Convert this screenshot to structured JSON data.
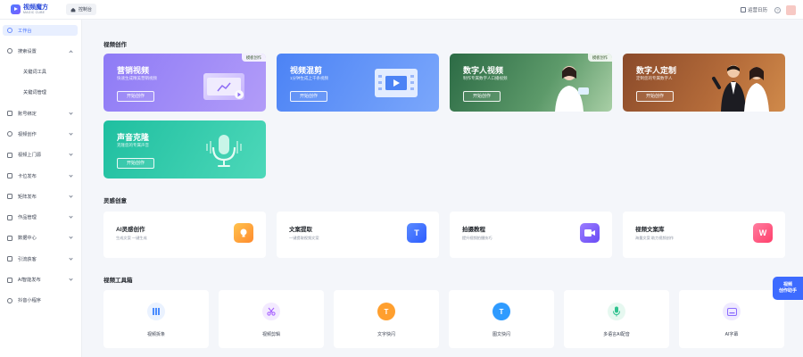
{
  "app": {
    "name": "视频魔方",
    "subtitle": "MAGIC CUBE",
    "home_tab": "控制台"
  },
  "topbar": {
    "calendar_label": "运营日历",
    "help_glyph": "?"
  },
  "sidebar": {
    "items": [
      {
        "label": "工作台",
        "icon": "home-icon",
        "active": true
      },
      {
        "label": "搜索设置",
        "icon": "search-icon",
        "expanded": true
      },
      {
        "label": "关键词工具",
        "sub": true
      },
      {
        "label": "关键词管理",
        "sub": true
      },
      {
        "label": "账号绑定",
        "icon": "account-icon"
      },
      {
        "label": "视频创作",
        "icon": "video-icon"
      },
      {
        "label": "视频上门源",
        "icon": "upload-icon"
      },
      {
        "label": "卡位发布",
        "icon": "publish-icon"
      },
      {
        "label": "矩阵发布",
        "icon": "matrix-icon"
      },
      {
        "label": "作品管理",
        "icon": "works-icon"
      },
      {
        "label": "数据中心",
        "icon": "data-icon"
      },
      {
        "label": "引流获客",
        "icon": "traffic-icon"
      },
      {
        "label": "AI智能发布",
        "icon": "ai-publish-icon"
      },
      {
        "label": "抖音小程序",
        "icon": "miniapp-icon"
      }
    ]
  },
  "sections": {
    "creation": "视频创作",
    "inspiration": "灵感创意",
    "tools": "视频工具箱"
  },
  "creation_cards": [
    {
      "title": "营销视频",
      "desc": "快速生成精美营销视频",
      "button": "开始创作",
      "badge": "模板创作"
    },
    {
      "title": "视频混剪",
      "desc": "1分钟生成上千条视频",
      "button": "开始创作"
    },
    {
      "title": "数字人视频",
      "desc": "制作专属数字人口播视频",
      "button": "开始创作",
      "badge": "模板创作"
    },
    {
      "title": "数字人定制",
      "desc": "定制您的专属数字人",
      "button": "开始创作"
    },
    {
      "title": "声音克隆",
      "desc": "克隆您的专属声音",
      "button": "开始创作"
    }
  ],
  "inspiration_cards": [
    {
      "title": "AI灵感创作",
      "desc": "生成文案 一键生成",
      "icon": "bulb-icon",
      "color": "#ff9f2e"
    },
    {
      "title": "文案提取",
      "desc": "一键提取视频文案",
      "icon": "text-extract-icon",
      "glyph": "T",
      "color": "#3d6bff"
    },
    {
      "title": "拍摄教程",
      "desc": "提升视频拍摄技巧",
      "icon": "tutorial-icon",
      "color": "#7a5cff"
    },
    {
      "title": "视频文案库",
      "desc": "海量文案 助力视频创作",
      "icon": "library-icon",
      "glyph": "W",
      "color": "#ff4f7b"
    }
  ],
  "tools": [
    {
      "label": "视频拆条",
      "icon": "split-icon",
      "color": "#4a8cff"
    },
    {
      "label": "视频剪辑",
      "icon": "scissors-icon",
      "color": "#a45cff"
    },
    {
      "label": "文字快闪",
      "icon": "text-flash-icon",
      "glyph": "T",
      "color": "#ff9f2e"
    },
    {
      "label": "图文快闪",
      "icon": "image-flash-icon",
      "glyph": "T",
      "color": "#2f9bff"
    },
    {
      "label": "多语言AI配音",
      "icon": "microphone-icon",
      "color": "#2fc28f"
    },
    {
      "label": "AI字幕",
      "icon": "subtitle-icon",
      "color": "#8a6cff"
    }
  ],
  "float_helper": {
    "line1": "视频",
    "line2": "创作助手"
  }
}
